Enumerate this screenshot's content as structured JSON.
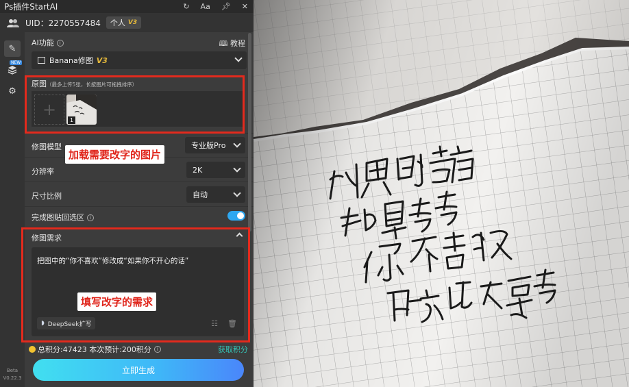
{
  "window": {
    "title": "Ps插件StartAI",
    "icons": [
      "refresh-icon",
      "font-size-icon",
      "pin-icon",
      "close-icon"
    ],
    "font_icon_text": "Aa"
  },
  "user": {
    "uid": "UID：2270557484",
    "plan": "个人",
    "plan_version": "V3"
  },
  "rail": {
    "new_badge": "NEW",
    "beta": "Beta",
    "version": "V0.22.3"
  },
  "ai_feature": {
    "label": "AI功能",
    "tutorial": "教程",
    "selected": "Banana修图",
    "selected_version": "V3"
  },
  "original": {
    "label": "原图",
    "hint": "（最多上传5张，长按图片可拖拽排序）",
    "add_symbol": "+",
    "thumb_count": "1"
  },
  "model": {
    "label": "修图模型",
    "value": "专业版Pro"
  },
  "resolution": {
    "label": "分辨率",
    "value": "2K"
  },
  "aspect": {
    "label": "尺寸比例",
    "value": "自动"
  },
  "paste_back": {
    "label": "完成图贴回选区",
    "enabled": true
  },
  "requirement": {
    "label": "修图需求",
    "text": "把图中的“你不喜欢”修改成“如果你不开心的话”",
    "deepseek_label": "DeepSeek扩写"
  },
  "points": {
    "summary": "总积分:47423  本次预计:200积分",
    "get_link": "获取积分"
  },
  "generate_button": "立即生成",
  "annotations": {
    "load_image": "加载需要改字的图片",
    "fill_requirement": "填写改字的需求"
  },
  "colors": {
    "panel_bg": "#3c3c3c",
    "accent_red": "#e42a1d",
    "toggle_blue": "#2ea7f0",
    "link_teal": "#35c3b6",
    "gold": "#e3b73b"
  }
}
